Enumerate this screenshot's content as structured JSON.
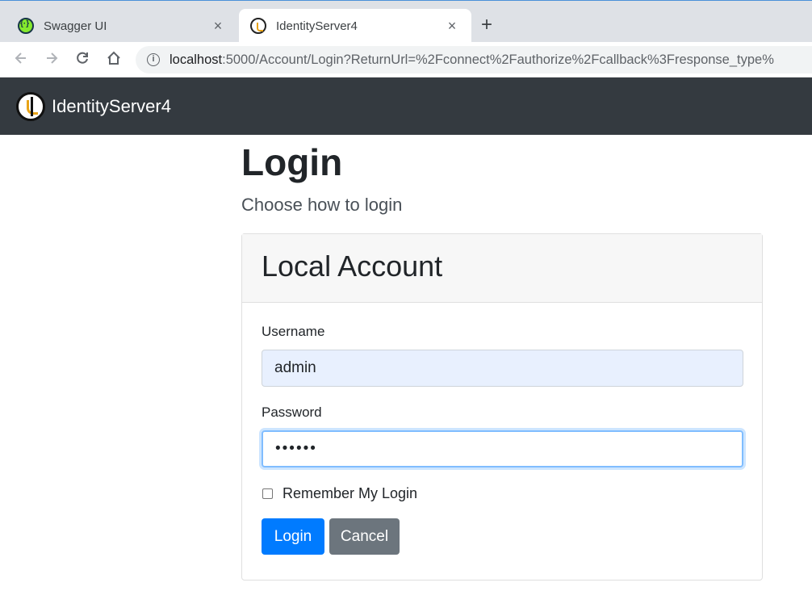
{
  "browser": {
    "tabs": [
      {
        "title": "Swagger UI",
        "favicon": "swagger-icon",
        "active": false
      },
      {
        "title": "IdentityServer4",
        "favicon": "identityserver-icon",
        "active": true
      }
    ],
    "new_tab_symbol": "+",
    "close_symbol": "×",
    "url_host": "localhost",
    "url_rest": ":5000/Account/Login?ReturnUrl=%2Fconnect%2Fauthorize%2Fcallback%3Fresponse_type%"
  },
  "navbar": {
    "brand": "IdentityServer4"
  },
  "page": {
    "title": "Login",
    "subtitle": "Choose how to login"
  },
  "card": {
    "header": "Local Account",
    "username_label": "Username",
    "username_value": "admin",
    "password_label": "Password",
    "password_value": "••••••",
    "remember_label": "Remember My Login",
    "remember_checked": false,
    "login_button": "Login",
    "cancel_button": "Cancel"
  },
  "colors": {
    "navbar_bg": "#343a40",
    "primary": "#007bff",
    "secondary": "#6c757d",
    "autofill_bg": "#e8f0fe"
  }
}
